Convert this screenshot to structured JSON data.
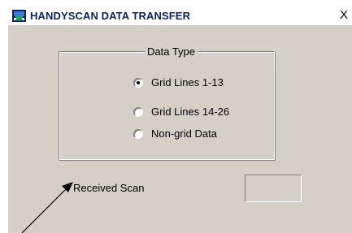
{
  "window": {
    "title": "HANDYSCAN DATA TRANSFER",
    "close_glyph": "X",
    "app_icon": "handyscan-app-icon"
  },
  "data_type_group": {
    "legend": "Data Type",
    "options": [
      {
        "label": "Grid Lines 1-13",
        "selected": true
      },
      {
        "label": "Grid Lines 14-26",
        "selected": false
      },
      {
        "label": "Non-grid Data",
        "selected": false
      }
    ]
  },
  "received_scan": {
    "label": "Received Scan",
    "value": ""
  },
  "colors": {
    "dialog_face": "#d4d0c8",
    "title_text": "#0a246a",
    "annotation": "#000000"
  }
}
